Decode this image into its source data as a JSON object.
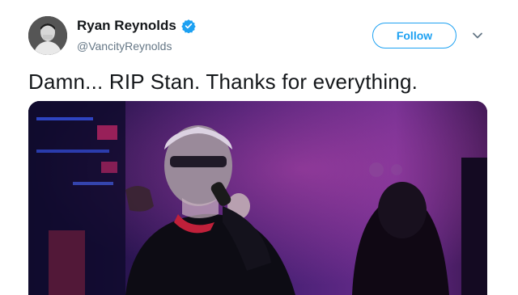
{
  "tweet": {
    "author": {
      "name": "Ryan Reynolds",
      "handle": "@VancityReynolds",
      "verified": true
    },
    "text": "Damn... RIP Stan. Thanks for everything.",
    "follow_label": "Follow",
    "menu_icon": "chevron-down-icon"
  },
  "colors": {
    "accent": "#1da1f2",
    "name_text": "#14171a",
    "secondary_text": "#657786",
    "media_purple": "#5a2a8a",
    "media_magenta": "#b0309a"
  }
}
